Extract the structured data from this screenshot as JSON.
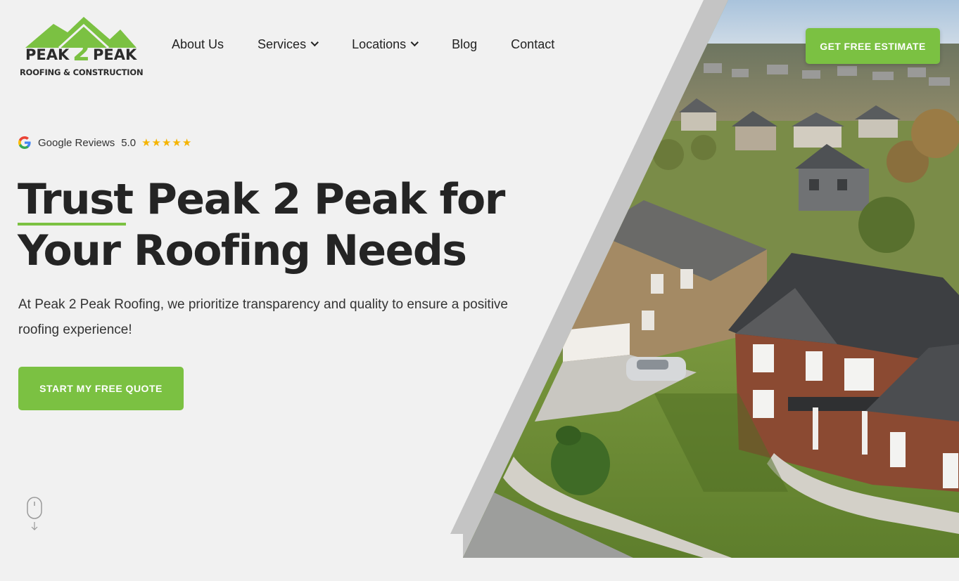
{
  "brand": {
    "logo_word_left": "PEAK",
    "logo_number": "2",
    "logo_word_right": "PEAK",
    "logo_subtitle": "ROOFING & CONSTRUCTION",
    "accent_color": "#7bc142",
    "text_color": "#242424"
  },
  "nav": {
    "items": [
      {
        "label": "About Us",
        "has_dropdown": false
      },
      {
        "label": "Services",
        "has_dropdown": true
      },
      {
        "label": "Locations",
        "has_dropdown": true
      },
      {
        "label": "Blog",
        "has_dropdown": false
      },
      {
        "label": "Contact",
        "has_dropdown": false
      }
    ]
  },
  "header": {
    "cta_label": "GET FREE ESTIMATE"
  },
  "hero": {
    "reviews_label": "Google Reviews",
    "reviews_score": "5.0",
    "reviews_stars": "★★★★★",
    "headline_line1": "Trust Peak 2 Peak for",
    "headline_line2": "Your Roofing Needs",
    "lead": "At Peak 2 Peak Roofing, we prioritize transparency and quality to ensure a positive roofing experience!",
    "cta_label": "START MY FREE QUOTE",
    "image_subject": "aerial photo of suburban houses with roofs and lawns"
  },
  "icons": {
    "google": "google-icon",
    "star": "star-icon",
    "chevron": "chevron-down-icon",
    "scroll": "mouse-scroll-icon"
  }
}
